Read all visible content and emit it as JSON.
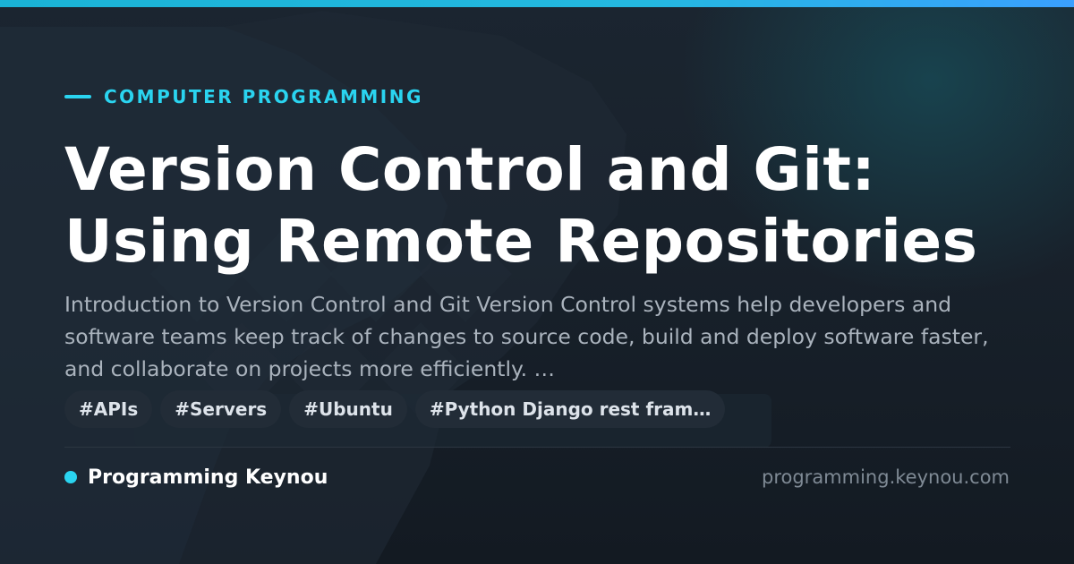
{
  "card": {
    "category": "COMPUTER PROGRAMMING",
    "title_lines": [
      "Version Control and Git:",
      "Using Remote Repositories"
    ],
    "description": "Introduction to Version Control and Git Version Control systems help developers and software teams keep track of changes to source code, build and deploy software faster, and collaborate on projects more efficiently. …",
    "tags": [
      "#APIs",
      "#Servers",
      "#Ubuntu",
      "#Python Django rest fram…"
    ],
    "brand": "Programming Keynou",
    "domain": "programming.keynou.com"
  },
  "colors": {
    "accent": "#2ad4f0",
    "background": "#18212b",
    "title": "#ffffff",
    "description": "#aab3bd",
    "tag_bg": "#222c37",
    "domain": "#7f8a95"
  }
}
